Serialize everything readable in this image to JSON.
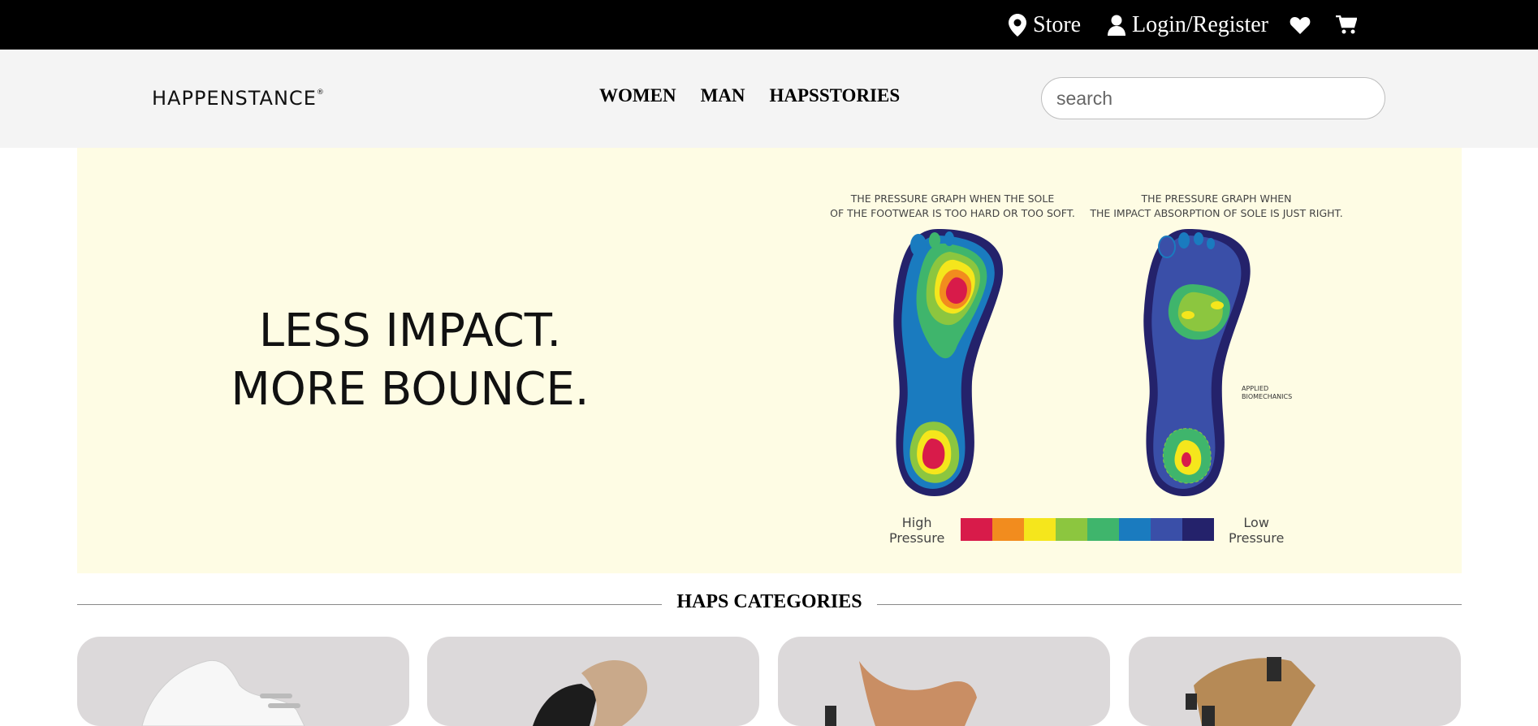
{
  "topbar": {
    "store_label": "Store",
    "login_label": "Login/Register",
    "icons": [
      "map-pin-icon",
      "user-icon",
      "heart-icon",
      "cart-icon"
    ]
  },
  "header": {
    "logo_text": "HAPPENSTANCE",
    "logo_mark": "®",
    "nav": [
      {
        "label": "WOMEN"
      },
      {
        "label": "MAN"
      },
      {
        "label": "HAPSSTORIES"
      }
    ],
    "search": {
      "placeholder": "search",
      "value": ""
    }
  },
  "banner": {
    "headline_line1": "LESS IMPACT.",
    "headline_line2": "MORE BOUNCE.",
    "left_caption_line1": "THE PRESSURE GRAPH WHEN THE SOLE",
    "left_caption_line2": "OF THE FOOTWEAR IS TOO HARD OR TOO SOFT.",
    "right_caption_line1": "THE PRESSURE GRAPH WHEN",
    "right_caption_line2": "THE IMPACT ABSORPTION OF SOLE IS JUST RIGHT.",
    "note_line1": "APPLIED",
    "note_line2": "BIOMECHANICS",
    "high_label_line1": "High",
    "high_label_line2": "Pressure",
    "low_label_line1": "Low",
    "low_label_line2": "Pressure",
    "scale_colors": [
      "#d81b4a",
      "#f28c1e",
      "#f5e61c",
      "#8cc63f",
      "#3fb56c",
      "#1a7bbf",
      "#3a4fa8",
      "#24226b"
    ],
    "background": "#fefce4"
  },
  "categories": {
    "title": "HAPS CATEGORIES",
    "cards": [
      {
        "product": "white-sneaker"
      },
      {
        "product": "black-sandal"
      },
      {
        "product": "tan-heel"
      },
      {
        "product": "brown-strap-sandal"
      }
    ],
    "card_color": "#dcd9da"
  }
}
